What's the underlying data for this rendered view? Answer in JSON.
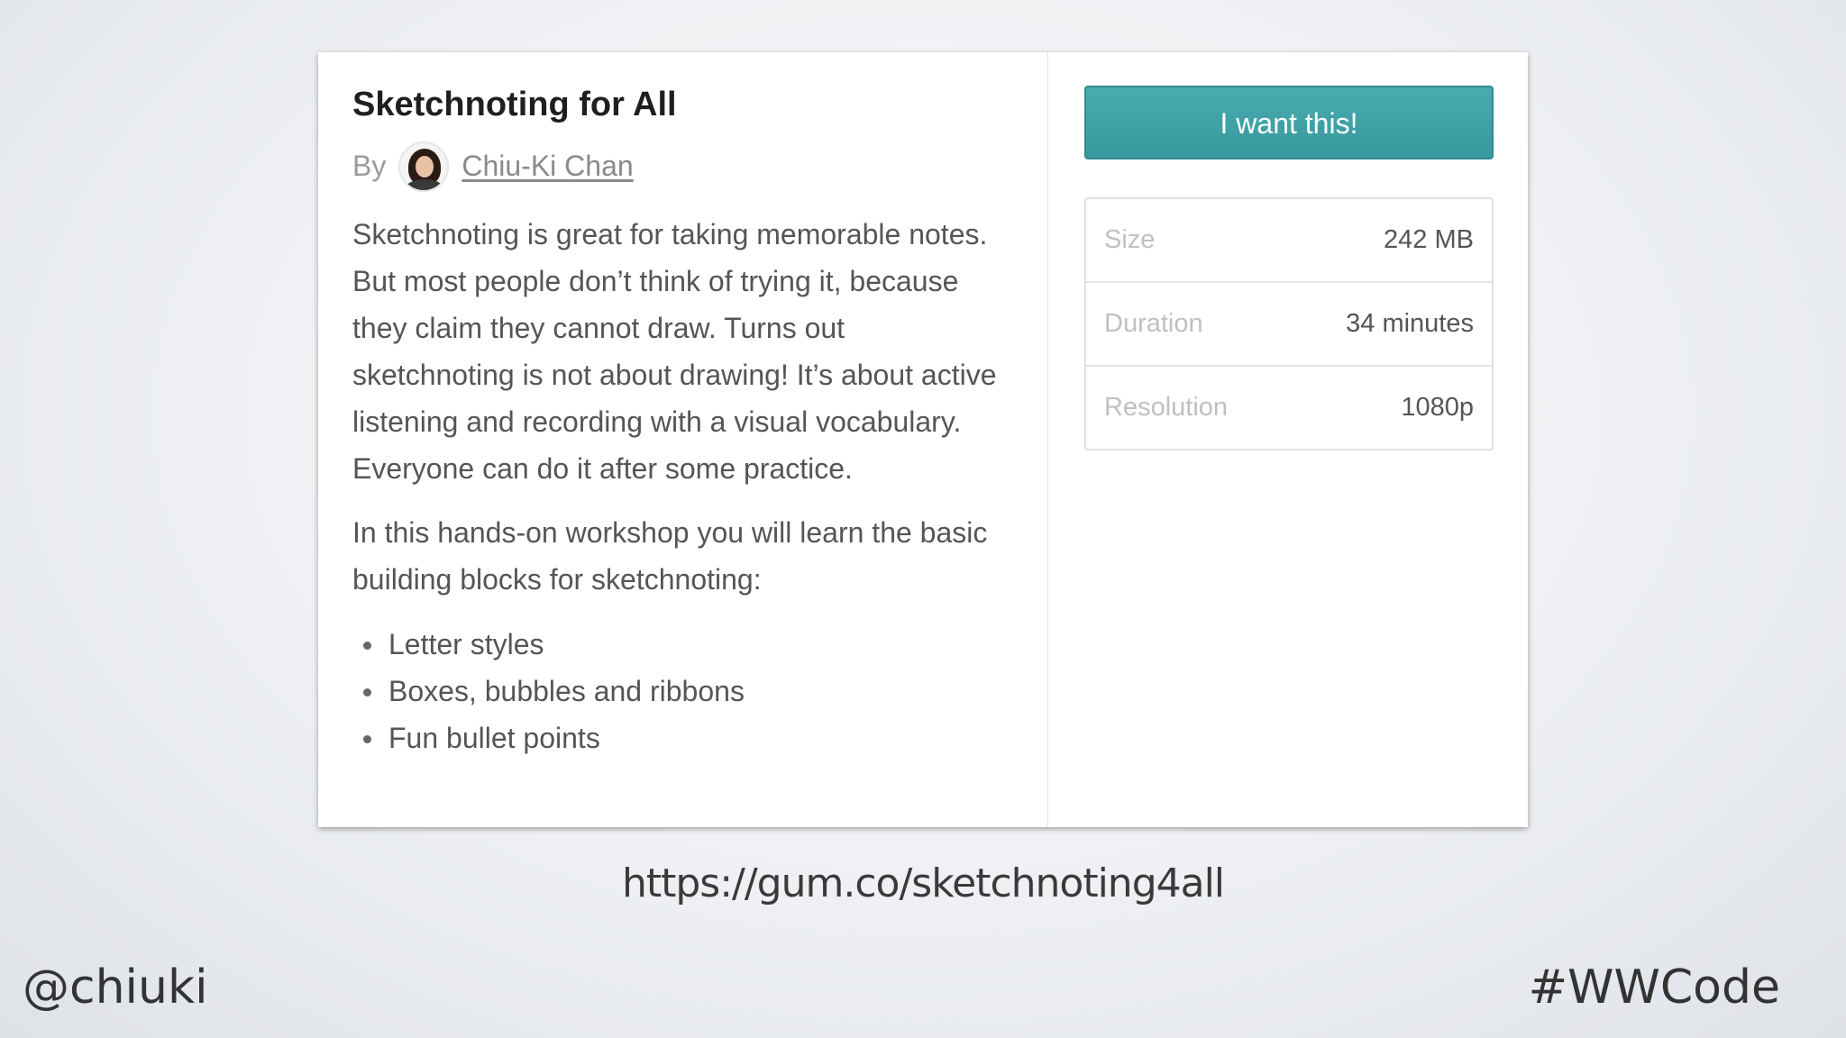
{
  "product": {
    "title": "Sketchnoting for All",
    "by_label": "By",
    "author": "Chiu-Ki Chan",
    "description": [
      "Sketchnoting is great for taking memorable notes. But most people don’t think of trying it, because they claim they cannot draw. Turns out sketchnoting is not about drawing! It’s about active listening and recording with a visual vocabulary. Everyone can do it after some practice.",
      "In this hands-on workshop you will learn the basic building blocks for sketchnoting:"
    ],
    "features": [
      "Letter styles",
      "Boxes, bubbles and ribbons",
      "Fun bullet points"
    ]
  },
  "purchase": {
    "button_label": "I want this!",
    "button_color": "#40a2a7"
  },
  "specs": [
    {
      "label": "Size",
      "value": "242 MB"
    },
    {
      "label": "Duration",
      "value": "34 minutes"
    },
    {
      "label": "Resolution",
      "value": "1080p"
    }
  ],
  "slide": {
    "url": "https://gum.co/sketchnoting4all",
    "handle": "@chiuki",
    "hashtag": "#WWCode"
  }
}
